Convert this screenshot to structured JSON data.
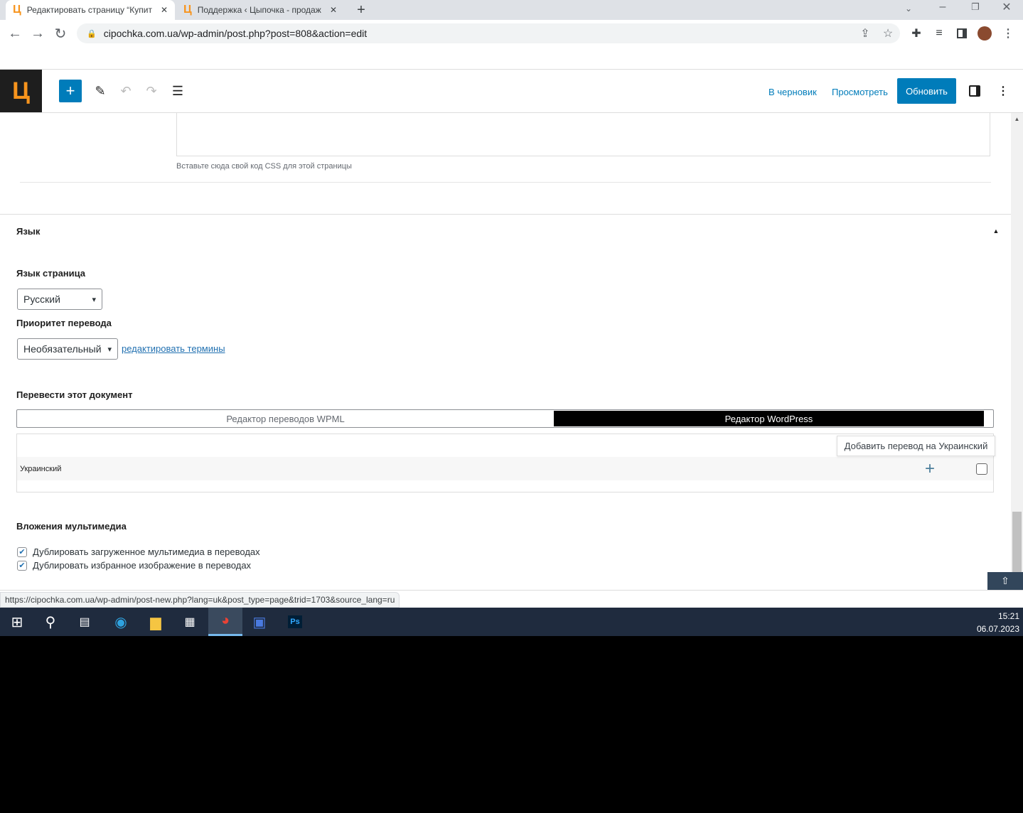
{
  "browser": {
    "tabs": [
      {
        "title": "Редактировать страницу “Купит",
        "favicon": "Ц"
      },
      {
        "title": "Поддержка ‹ Цыпочка - продаж",
        "favicon": "Ц"
      }
    ],
    "url": "cipochka.com.ua/wp-admin/post.php?post=808&action=edit",
    "status_url": "https://cipochka.com.ua/wp-admin/post-new.php?lang=uk&post_type=page&trid=1703&source_lang=ru"
  },
  "editor": {
    "logo": "Ц",
    "draft_label": "В черновик",
    "preview_label": "Просмотреть",
    "update_label": "Обновить",
    "accent": "#007cba"
  },
  "css_box": {
    "help": "Вставьте сюда свой код CSS для этой страницы"
  },
  "language_panel": {
    "title": "Язык",
    "page_language_label": "Язык страница",
    "page_language_value": "Русский",
    "priority_label": "Приоритет перевода",
    "priority_value": "Необязательный",
    "edit_terms_link": "редактировать термины",
    "translate_label": "Перевести этот документ",
    "editor_options": [
      "Редактор переводов WPML",
      "Редактор WordPress"
    ],
    "selected_editor": "Редактор WordPress",
    "languages": [
      {
        "name": "Украинский",
        "tooltip": "Добавить перевод на Украинский"
      }
    ],
    "media_label": "Вложения мультимедиа",
    "media_options": [
      {
        "label": "Дублировать загруженное мультимедиа в переводах",
        "checked": true
      },
      {
        "label": "Дублировать избранное изображение в переводах",
        "checked": true
      }
    ]
  },
  "taskbar": {
    "time": "15:21",
    "date": "06.07.2023",
    "ps_label": "Ps"
  }
}
